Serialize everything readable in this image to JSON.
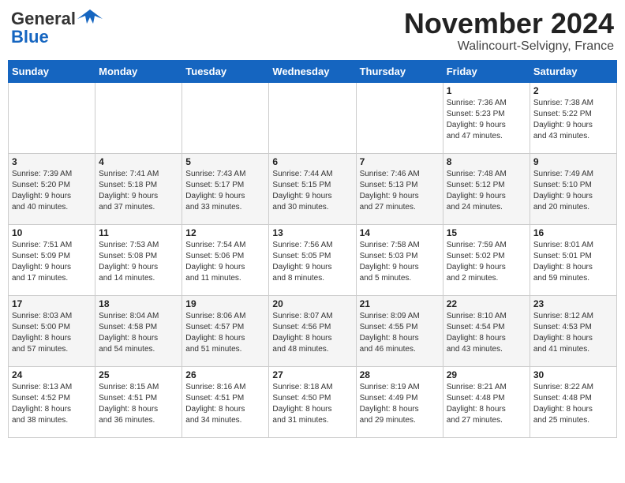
{
  "header": {
    "logo_general": "General",
    "logo_blue": "Blue",
    "month_title": "November 2024",
    "subtitle": "Walincourt-Selvigny, France"
  },
  "days_of_week": [
    "Sunday",
    "Monday",
    "Tuesday",
    "Wednesday",
    "Thursday",
    "Friday",
    "Saturday"
  ],
  "weeks": [
    [
      {
        "day": "",
        "info": ""
      },
      {
        "day": "",
        "info": ""
      },
      {
        "day": "",
        "info": ""
      },
      {
        "day": "",
        "info": ""
      },
      {
        "day": "",
        "info": ""
      },
      {
        "day": "1",
        "info": "Sunrise: 7:36 AM\nSunset: 5:23 PM\nDaylight: 9 hours\nand 47 minutes."
      },
      {
        "day": "2",
        "info": "Sunrise: 7:38 AM\nSunset: 5:22 PM\nDaylight: 9 hours\nand 43 minutes."
      }
    ],
    [
      {
        "day": "3",
        "info": "Sunrise: 7:39 AM\nSunset: 5:20 PM\nDaylight: 9 hours\nand 40 minutes."
      },
      {
        "day": "4",
        "info": "Sunrise: 7:41 AM\nSunset: 5:18 PM\nDaylight: 9 hours\nand 37 minutes."
      },
      {
        "day": "5",
        "info": "Sunrise: 7:43 AM\nSunset: 5:17 PM\nDaylight: 9 hours\nand 33 minutes."
      },
      {
        "day": "6",
        "info": "Sunrise: 7:44 AM\nSunset: 5:15 PM\nDaylight: 9 hours\nand 30 minutes."
      },
      {
        "day": "7",
        "info": "Sunrise: 7:46 AM\nSunset: 5:13 PM\nDaylight: 9 hours\nand 27 minutes."
      },
      {
        "day": "8",
        "info": "Sunrise: 7:48 AM\nSunset: 5:12 PM\nDaylight: 9 hours\nand 24 minutes."
      },
      {
        "day": "9",
        "info": "Sunrise: 7:49 AM\nSunset: 5:10 PM\nDaylight: 9 hours\nand 20 minutes."
      }
    ],
    [
      {
        "day": "10",
        "info": "Sunrise: 7:51 AM\nSunset: 5:09 PM\nDaylight: 9 hours\nand 17 minutes."
      },
      {
        "day": "11",
        "info": "Sunrise: 7:53 AM\nSunset: 5:08 PM\nDaylight: 9 hours\nand 14 minutes."
      },
      {
        "day": "12",
        "info": "Sunrise: 7:54 AM\nSunset: 5:06 PM\nDaylight: 9 hours\nand 11 minutes."
      },
      {
        "day": "13",
        "info": "Sunrise: 7:56 AM\nSunset: 5:05 PM\nDaylight: 9 hours\nand 8 minutes."
      },
      {
        "day": "14",
        "info": "Sunrise: 7:58 AM\nSunset: 5:03 PM\nDaylight: 9 hours\nand 5 minutes."
      },
      {
        "day": "15",
        "info": "Sunrise: 7:59 AM\nSunset: 5:02 PM\nDaylight: 9 hours\nand 2 minutes."
      },
      {
        "day": "16",
        "info": "Sunrise: 8:01 AM\nSunset: 5:01 PM\nDaylight: 8 hours\nand 59 minutes."
      }
    ],
    [
      {
        "day": "17",
        "info": "Sunrise: 8:03 AM\nSunset: 5:00 PM\nDaylight: 8 hours\nand 57 minutes."
      },
      {
        "day": "18",
        "info": "Sunrise: 8:04 AM\nSunset: 4:58 PM\nDaylight: 8 hours\nand 54 minutes."
      },
      {
        "day": "19",
        "info": "Sunrise: 8:06 AM\nSunset: 4:57 PM\nDaylight: 8 hours\nand 51 minutes."
      },
      {
        "day": "20",
        "info": "Sunrise: 8:07 AM\nSunset: 4:56 PM\nDaylight: 8 hours\nand 48 minutes."
      },
      {
        "day": "21",
        "info": "Sunrise: 8:09 AM\nSunset: 4:55 PM\nDaylight: 8 hours\nand 46 minutes."
      },
      {
        "day": "22",
        "info": "Sunrise: 8:10 AM\nSunset: 4:54 PM\nDaylight: 8 hours\nand 43 minutes."
      },
      {
        "day": "23",
        "info": "Sunrise: 8:12 AM\nSunset: 4:53 PM\nDaylight: 8 hours\nand 41 minutes."
      }
    ],
    [
      {
        "day": "24",
        "info": "Sunrise: 8:13 AM\nSunset: 4:52 PM\nDaylight: 8 hours\nand 38 minutes."
      },
      {
        "day": "25",
        "info": "Sunrise: 8:15 AM\nSunset: 4:51 PM\nDaylight: 8 hours\nand 36 minutes."
      },
      {
        "day": "26",
        "info": "Sunrise: 8:16 AM\nSunset: 4:51 PM\nDaylight: 8 hours\nand 34 minutes."
      },
      {
        "day": "27",
        "info": "Sunrise: 8:18 AM\nSunset: 4:50 PM\nDaylight: 8 hours\nand 31 minutes."
      },
      {
        "day": "28",
        "info": "Sunrise: 8:19 AM\nSunset: 4:49 PM\nDaylight: 8 hours\nand 29 minutes."
      },
      {
        "day": "29",
        "info": "Sunrise: 8:21 AM\nSunset: 4:48 PM\nDaylight: 8 hours\nand 27 minutes."
      },
      {
        "day": "30",
        "info": "Sunrise: 8:22 AM\nSunset: 4:48 PM\nDaylight: 8 hours\nand 25 minutes."
      }
    ]
  ]
}
